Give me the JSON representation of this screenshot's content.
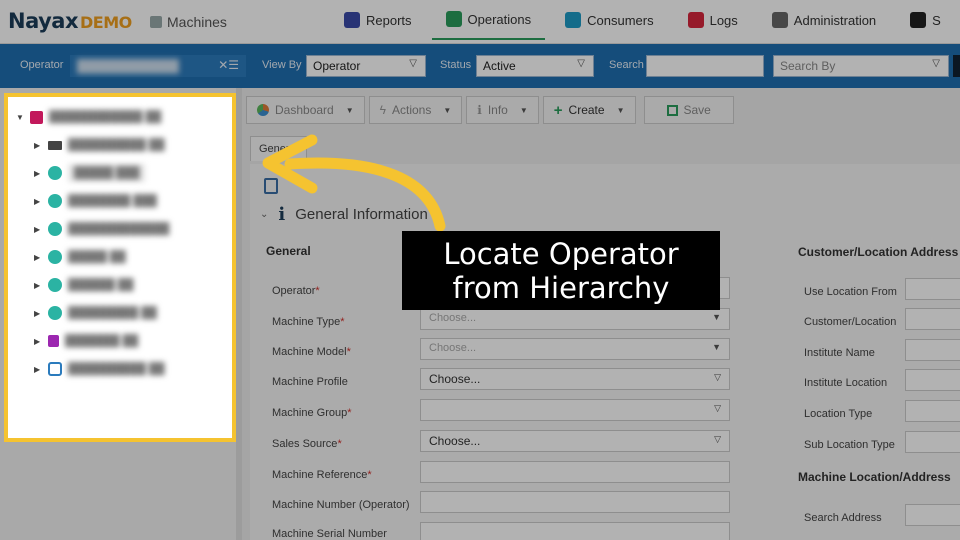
{
  "header": {
    "brand": "Nayax",
    "brand_suffix": "DEMO",
    "section_label": "Machines",
    "nav": [
      {
        "label": "Reports",
        "icon": "reports-icon",
        "color": "#3a4aa8"
      },
      {
        "label": "Operations",
        "icon": "operations-icon",
        "color": "#2a9d5c"
      },
      {
        "label": "Consumers",
        "icon": "consumers-icon",
        "color": "#1e9bc6"
      },
      {
        "label": "Logs",
        "icon": "logs-icon",
        "color": "#d7263d"
      },
      {
        "label": "Administration",
        "icon": "administration-icon",
        "color": "#666666"
      },
      {
        "label": "S",
        "icon": "settings-icon",
        "color": "#222222"
      }
    ]
  },
  "filterbar": {
    "operator_label": "Operator",
    "view_by_label": "View By",
    "view_by_value": "Operator",
    "status_label": "Status",
    "status_value": "Active",
    "search_label": "Search",
    "search_by_placeholder": "Search By"
  },
  "toolbar": {
    "dashboard": "Dashboard",
    "actions": "Actions",
    "info": "Info",
    "create": "Create",
    "save": "Save"
  },
  "tab_general": "General",
  "section_title": "General Information",
  "general": {
    "heading": "General",
    "fields": [
      {
        "label": "Operator",
        "required": true,
        "value": ""
      },
      {
        "label": "Machine Type",
        "required": true,
        "value": "Choose..."
      },
      {
        "label": "Machine Model",
        "required": true,
        "value": "Choose..."
      },
      {
        "label": "Machine Profile",
        "required": false,
        "value": "Choose..."
      },
      {
        "label": "Machine Group",
        "required": true,
        "value": ""
      },
      {
        "label": "Sales Source",
        "required": true,
        "value": "Choose..."
      },
      {
        "label": "Machine Reference",
        "required": true,
        "value": ""
      },
      {
        "label": "Machine Number (Operator)",
        "required": false,
        "value": ""
      },
      {
        "label": "Machine Serial Number",
        "required": false,
        "value": ""
      }
    ]
  },
  "customer": {
    "heading": "Customer/Location Address",
    "fields": [
      "Use Location From",
      "Customer/Location",
      "Institute Name",
      "Institute Location",
      "Location Type",
      "Sub Location Type"
    ],
    "machine_location_heading": "Machine Location/Address",
    "search_address_label": "Search Address"
  },
  "callout": {
    "line1": "Locate Operator",
    "line2": "from Hierarchy"
  },
  "accent_color": "#f5c330"
}
